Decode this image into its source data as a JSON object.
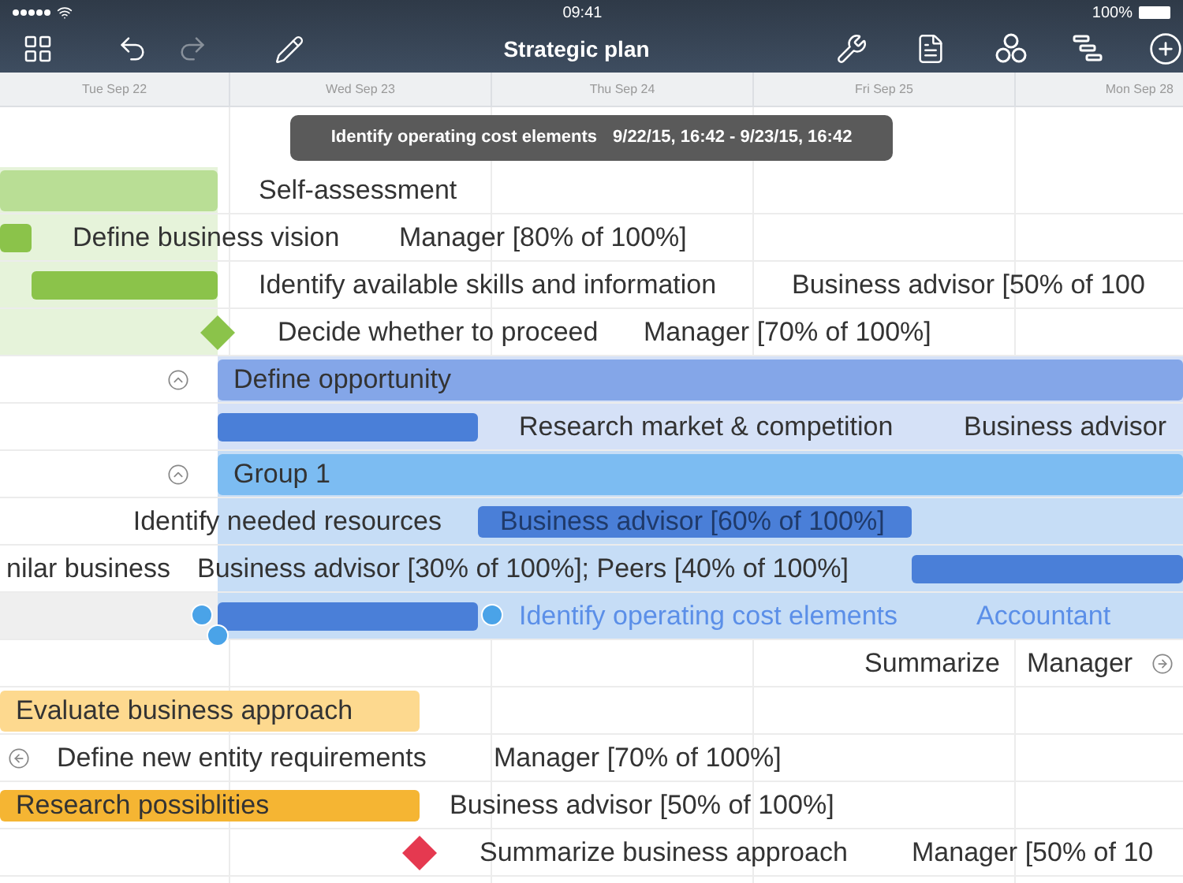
{
  "status_bar": {
    "time": "09:41",
    "battery": "100%"
  },
  "toolbar": {
    "title": "Strategic plan",
    "undo": {
      "disabled": false
    },
    "redo": {
      "disabled": true
    }
  },
  "timeline": {
    "dates": [
      "Tue Sep 22",
      "Wed Sep 23",
      "Thu Sep 24",
      "Fri Sep 25",
      "Mon Sep 28"
    ]
  },
  "tooltip": {
    "task": "Identify operating cost elements",
    "range": "9/22/15, 16:42 - 9/23/15, 16:42"
  },
  "rows": [
    {
      "kind": "group",
      "title": "Self-assessment",
      "color": "#b9de95",
      "selected": false
    },
    {
      "kind": "task",
      "title": "Define business vision",
      "resource": "Manager [80% of 100%]",
      "color": "#8bc34a",
      "selected": false
    },
    {
      "kind": "task",
      "title": "Identify available skills and information",
      "resource": "Business advisor [50% of 100",
      "color": "#8bc34a",
      "selected": false
    },
    {
      "kind": "milestone",
      "title": "Decide whether to proceed",
      "resource": "Manager [70% of 100%]",
      "color": "#8bc34a",
      "selected": false
    },
    {
      "kind": "group",
      "title": "Define opportunity",
      "color": "#84a6e8",
      "expanded": true,
      "selected": false
    },
    {
      "kind": "task",
      "title": "Research market & competition",
      "resource": "Business advisor",
      "color": "#4a7fd8",
      "selected": false
    },
    {
      "kind": "group",
      "title": "Group 1",
      "color": "#7cbcf2",
      "expanded": true,
      "selected": false
    },
    {
      "kind": "task",
      "title": "Identify needed resources",
      "resource": "Business advisor [60% of 100%]",
      "color": "#4a7fd8",
      "selected": false
    },
    {
      "kind": "task",
      "title": "nilar business",
      "resource": "Business advisor [30% of 100%]; Peers [40% of 100%]",
      "color": "#4a7fd8",
      "selected": false
    },
    {
      "kind": "task",
      "title": "Identify operating cost elements",
      "resource": "Accountant",
      "color": "#4a7fd8",
      "selected": true
    },
    {
      "kind": "offscreen",
      "title": "Summarize",
      "resource": "Manager",
      "selected": false
    },
    {
      "kind": "group",
      "title": "Evaluate business approach",
      "color": "#fdd98f",
      "selected": false
    },
    {
      "kind": "offscreen",
      "title": "Define new entity requirements",
      "resource": "Manager [70% of 100%]",
      "selected": false
    },
    {
      "kind": "task",
      "title": "Research possiblities",
      "resource": "Business advisor [50% of 100%]",
      "color": "#f5b533",
      "selected": false
    },
    {
      "kind": "milestone",
      "title": "Summarize business approach",
      "resource": "Manager [50% of 10",
      "color": "#e53950",
      "selected": false
    }
  ]
}
